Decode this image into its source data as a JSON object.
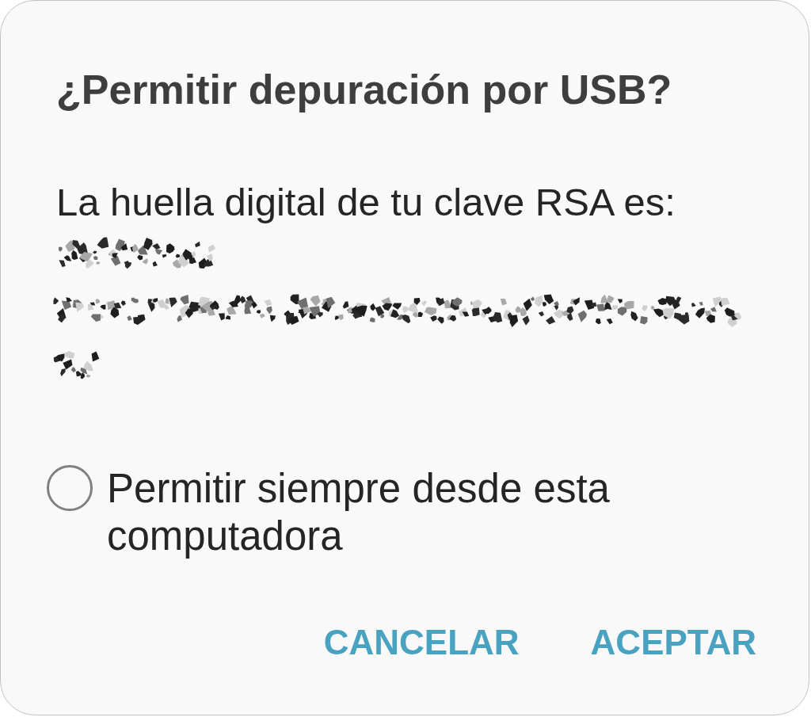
{
  "dialog": {
    "title": "¿Permitir depuración por USB?",
    "message": "La huella digital de tu clave RSA es:",
    "fingerprint_lines": [
      {
        "redacted": true
      },
      {
        "redacted": true
      },
      {
        "redacted": true
      }
    ],
    "options": [
      {
        "kind": "radio",
        "label": "Permitir siempre desde esta computadora",
        "checked": false
      }
    ],
    "buttons": [
      {
        "label": "CANCELAR"
      },
      {
        "label": "ACEPTAR"
      }
    ]
  }
}
